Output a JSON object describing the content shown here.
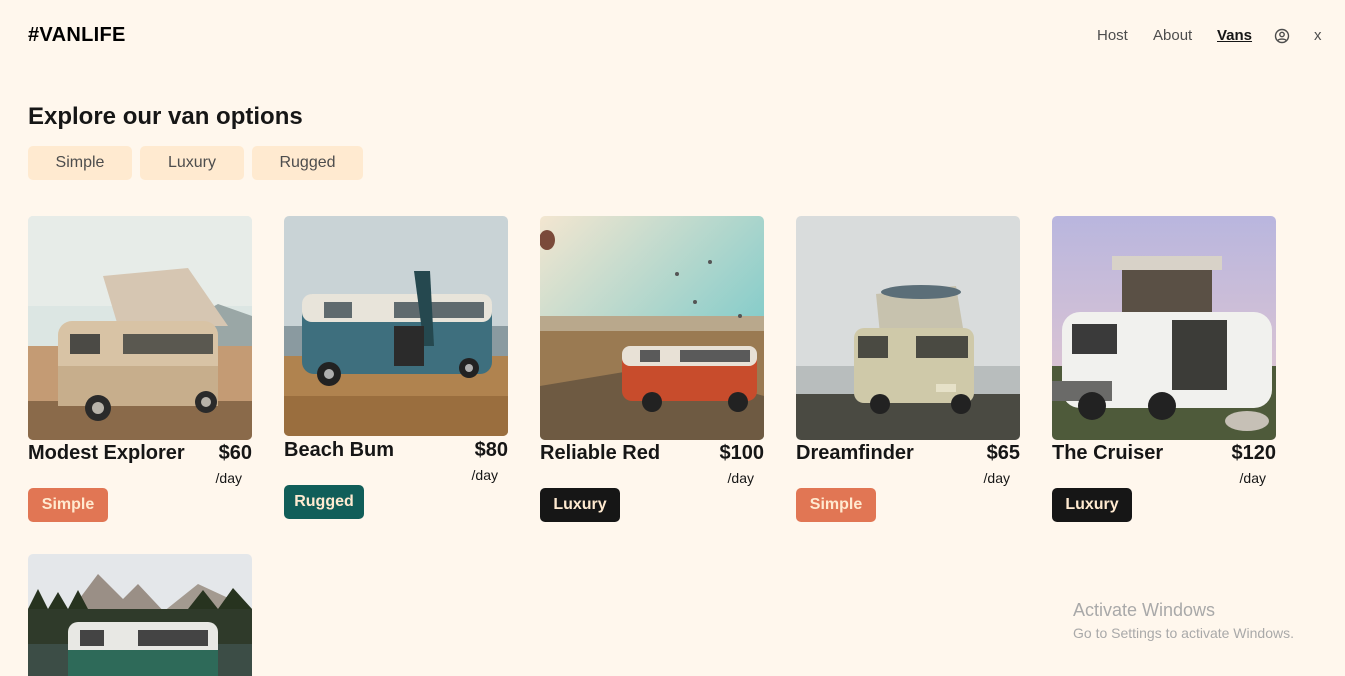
{
  "app": {
    "logo": "#VANLIFE"
  },
  "nav": {
    "host": "Host",
    "about": "About",
    "vans": "Vans",
    "user_icon": "user-circle-icon",
    "logout": "x"
  },
  "page": {
    "title": "Explore our van options"
  },
  "filters": [
    {
      "label": "Simple"
    },
    {
      "label": "Luxury"
    },
    {
      "label": "Rugged"
    }
  ],
  "vans": [
    {
      "name": "Modest Explorer",
      "price": "$60",
      "per": "/day",
      "type": "Simple"
    },
    {
      "name": "Beach Bum",
      "price": "$80",
      "per": "/day",
      "type": "Rugged"
    },
    {
      "name": "Reliable Red",
      "price": "$100",
      "per": "/day",
      "type": "Luxury"
    },
    {
      "name": "Dreamfinder",
      "price": "$65",
      "per": "/day",
      "type": "Simple"
    },
    {
      "name": "The Cruiser",
      "price": "$120",
      "per": "/day",
      "type": "Luxury"
    }
  ],
  "watermark": {
    "line1": "Activate Windows",
    "line2": "Go to Settings to activate Windows."
  },
  "colors": {
    "background": "#FFF7ED",
    "filter_bg": "#FFEAD0",
    "simple": "#E17654",
    "rugged": "#115E59",
    "luxury": "#161616"
  }
}
